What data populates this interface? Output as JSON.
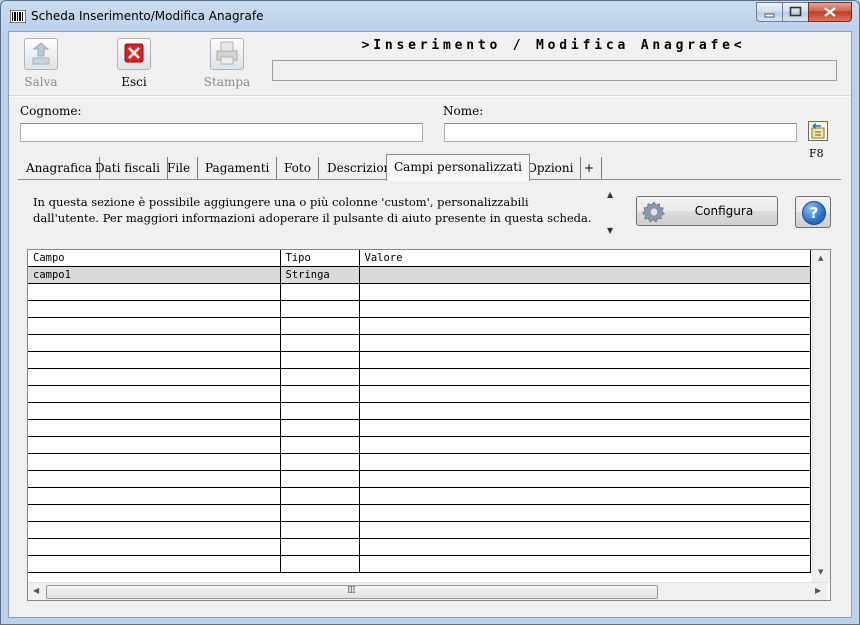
{
  "window": {
    "title": "Scheda Inserimento/Modifica Anagrafe"
  },
  "toolbar": {
    "save_label": "Salva",
    "exit_label": "Esci",
    "print_label": "Stampa"
  },
  "banner": {
    "text": ">Inserimento / Modifica  Anagrafe<"
  },
  "form": {
    "cognome_label": "Cognome:",
    "cognome_value": "",
    "nome_label": "Nome:",
    "nome_value": "",
    "swap_shortcut": "F8"
  },
  "tabs": [
    {
      "label": "Anagrafica",
      "active": false
    },
    {
      "label": "Dati fiscali",
      "active": false
    },
    {
      "label": "File",
      "active": false
    },
    {
      "label": "Pagamenti",
      "active": false
    },
    {
      "label": "Foto",
      "active": false
    },
    {
      "label": "Descrizione",
      "active": false
    },
    {
      "label": "Campi personalizzati",
      "active": true
    },
    {
      "label": "Opzioni",
      "active": false
    },
    {
      "label": "+",
      "active": false
    }
  ],
  "custom_fields": {
    "info": "In questa sezione è possibile aggiungere una o più colonne 'custom', personalizzabili dall'utente. Per maggiori informazioni adoperare il pulsante di aiuto presente in questa scheda.",
    "configure_label": "Configura",
    "help_icon": "?",
    "columns": [
      "Campo",
      "Tipo",
      "Valore"
    ],
    "rows": [
      [
        "campo1",
        "Stringa",
        ""
      ]
    ],
    "selected_row": 0
  },
  "colors": {
    "window_frame": "#bcd2eb",
    "close_button": "#c03a21",
    "selected_row": "#d9d9d9"
  }
}
